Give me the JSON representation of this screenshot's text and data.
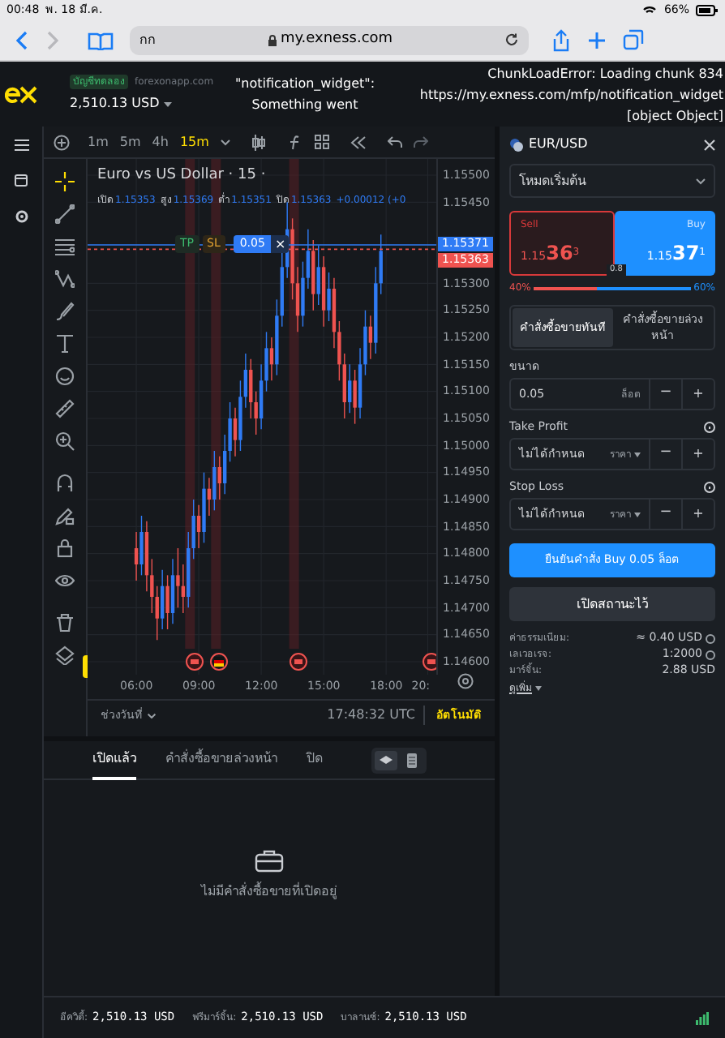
{
  "status_bar": {
    "time": "00:48",
    "date": "พ. 18 มี.ค.",
    "battery": "66%"
  },
  "browser": {
    "text_size": "กก",
    "url": "my.exness.com"
  },
  "header": {
    "account_badge": "บัญชีทดลอง",
    "server": "forexonapp.com",
    "balance": "2,510.13 USD",
    "error_1": [
      "\"notification_widget\":",
      "Something went"
    ],
    "error_2": [
      "ChunkLoadError: Loading chunk 834",
      "https://my.exness.com/mfp/notification_widget",
      "[object Object]"
    ]
  },
  "timeframes": [
    {
      "label": "1m",
      "selected": false
    },
    {
      "label": "5m",
      "selected": false
    },
    {
      "label": "4h",
      "selected": false
    },
    {
      "label": "15m",
      "selected": true
    }
  ],
  "chart": {
    "title": "Euro vs US Dollar · 15 ·",
    "ohlc": [
      {
        "label": "เปิด",
        "value": "1.15353"
      },
      {
        "label": "สูง",
        "value": "1.15369"
      },
      {
        "label": "ต่ำ",
        "value": "1.15351"
      },
      {
        "label": "ปิด",
        "value": "1.15363"
      }
    ],
    "change": "+0.00012 (+0",
    "order_line": {
      "tp": "TP",
      "sl": "SL",
      "volume": "0.05",
      "close": "×"
    },
    "chart_data": {
      "type": "candlestick",
      "x": [
        6,
        6.25,
        6.5,
        6.75,
        7,
        7.25,
        7.5,
        7.75,
        8,
        8.25,
        8.5,
        8.75,
        9,
        9.25,
        9.5,
        9.75,
        10,
        10.25,
        10.5,
        10.75,
        11,
        11.25,
        11.5,
        11.75,
        12,
        12.25,
        12.5,
        12.75,
        13,
        13.25,
        13.5,
        13.75,
        14,
        14.25,
        14.5,
        14.75,
        15,
        15.25,
        15.5,
        15.75,
        16,
        16.25,
        16.5,
        16.75,
        17,
        17.25,
        17.5,
        17.75
      ],
      "xlim": [
        3.66,
        20.41
      ],
      "ylim": [
        1.14576,
        1.1553
      ],
      "grid": true,
      "ref_lines": [
        {
          "axis": "y",
          "value": 1.15371,
          "label": "1.15371",
          "color": "#2f7bf5"
        },
        {
          "axis": "y",
          "value": 1.15363,
          "label": "1.15363",
          "color": "#ef5350"
        }
      ],
      "ohlc": [
        [
          1.1481,
          1.1484,
          1.1475,
          1.1478
        ],
        [
          1.1478,
          1.1487,
          1.1476,
          1.1484
        ],
        [
          1.1484,
          1.1486,
          1.1473,
          1.1476
        ],
        [
          1.1476,
          1.1479,
          1.1469,
          1.1472
        ],
        [
          1.1472,
          1.1474,
          1.1464,
          1.1468
        ],
        [
          1.1468,
          1.1477,
          1.1466,
          1.1474
        ],
        [
          1.1474,
          1.1476,
          1.1466,
          1.1469
        ],
        [
          1.1469,
          1.1479,
          1.1467,
          1.1476
        ],
        [
          1.1476,
          1.1481,
          1.147,
          1.1474
        ],
        [
          1.1474,
          1.1478,
          1.1469,
          1.1472
        ],
        [
          1.1472,
          1.1484,
          1.147,
          1.1481
        ],
        [
          1.1481,
          1.149,
          1.1479,
          1.1487
        ],
        [
          1.1487,
          1.1489,
          1.1481,
          1.1484
        ],
        [
          1.1484,
          1.1495,
          1.1482,
          1.1492
        ],
        [
          1.1492,
          1.1494,
          1.1487,
          1.149
        ],
        [
          1.149,
          1.1499,
          1.1488,
          1.1496
        ],
        [
          1.1496,
          1.1498,
          1.149,
          1.1493
        ],
        [
          1.1493,
          1.1502,
          1.1491,
          1.1499
        ],
        [
          1.1499,
          1.1508,
          1.1497,
          1.1505
        ],
        [
          1.1505,
          1.1507,
          1.1498,
          1.1501
        ],
        [
          1.1501,
          1.1512,
          1.1499,
          1.1509
        ],
        [
          1.1509,
          1.1517,
          1.1507,
          1.1514
        ],
        [
          1.1514,
          1.1516,
          1.1505,
          1.1508
        ],
        [
          1.1508,
          1.151,
          1.1502,
          1.1505
        ],
        [
          1.1505,
          1.1515,
          1.1503,
          1.1512
        ],
        [
          1.1512,
          1.1521,
          1.151,
          1.1518
        ],
        [
          1.1518,
          1.152,
          1.1512,
          1.1515
        ],
        [
          1.1515,
          1.1527,
          1.1513,
          1.1524
        ],
        [
          1.1524,
          1.1536,
          1.1522,
          1.1533
        ],
        [
          1.1533,
          1.1545,
          1.1531,
          1.154
        ],
        [
          1.154,
          1.1542,
          1.1527,
          1.153
        ],
        [
          1.153,
          1.1533,
          1.1521,
          1.1524
        ],
        [
          1.1524,
          1.1534,
          1.1522,
          1.1531
        ],
        [
          1.1531,
          1.154,
          1.1529,
          1.1536
        ],
        [
          1.1536,
          1.1538,
          1.1525,
          1.1528
        ],
        [
          1.1528,
          1.1537,
          1.1526,
          1.1533
        ],
        [
          1.1533,
          1.1535,
          1.1522,
          1.1525
        ],
        [
          1.1525,
          1.1532,
          1.1523,
          1.1529
        ],
        [
          1.1529,
          1.1531,
          1.1518,
          1.1521
        ],
        [
          1.1521,
          1.1523,
          1.1512,
          1.1515
        ],
        [
          1.1515,
          1.1517,
          1.1505,
          1.1508
        ],
        [
          1.1508,
          1.1515,
          1.1506,
          1.1512
        ],
        [
          1.1512,
          1.1514,
          1.1504,
          1.1507
        ],
        [
          1.1507,
          1.1518,
          1.1505,
          1.1515
        ],
        [
          1.1515,
          1.1525,
          1.1513,
          1.1522
        ],
        [
          1.1522,
          1.1524,
          1.1516,
          1.1519
        ],
        [
          1.1519,
          1.1533,
          1.1517,
          1.153
        ],
        [
          1.153,
          1.1539,
          1.1528,
          1.1536
        ]
      ],
      "xticks": [
        {
          "value": 6,
          "label": "06:00"
        },
        {
          "value": 9,
          "label": "09:00"
        },
        {
          "value": 12,
          "label": "12:00"
        },
        {
          "value": 15,
          "label": "15:00"
        },
        {
          "value": 18,
          "label": "18:00"
        },
        {
          "value": 20,
          "label": "20:"
        }
      ],
      "yticks": [
        {
          "value": 1.155,
          "label": "1.15500"
        },
        {
          "value": 1.1545,
          "label": "1.15450"
        },
        {
          "value": 1.153,
          "label": "1.15300"
        },
        {
          "value": 1.1525,
          "label": "1.15250"
        },
        {
          "value": 1.152,
          "label": "1.15200"
        },
        {
          "value": 1.1515,
          "label": "1.15150"
        },
        {
          "value": 1.151,
          "label": "1.15100"
        },
        {
          "value": 1.1505,
          "label": "1.15050"
        },
        {
          "value": 1.15,
          "label": "1.15000"
        },
        {
          "value": 1.1495,
          "label": "1.14950"
        },
        {
          "value": 1.149,
          "label": "1.14900"
        },
        {
          "value": 1.1485,
          "label": "1.14850"
        },
        {
          "value": 1.148,
          "label": "1.14800"
        },
        {
          "value": 1.1475,
          "label": "1.14750"
        },
        {
          "value": 1.147,
          "label": "1.14700"
        },
        {
          "value": 1.1465,
          "label": "1.14650"
        },
        {
          "value": 1.146,
          "label": "1.14600"
        }
      ]
    },
    "date_range": "ช่วงวันที่",
    "clock": "17:48:32 UTC",
    "auto": "อัตโนมัติ"
  },
  "bottom_tabs": [
    {
      "label": "เปิดแล้ว",
      "selected": true
    },
    {
      "label": "คำสั่งซื้อขายล่วงหน้า",
      "selected": false
    },
    {
      "label": "ปิด",
      "selected": false
    }
  ],
  "empty_message": "ไม่มีคำสั่งซื้อขายที่เปิดอยู่",
  "footer": [
    {
      "label": "อีควิตี้:",
      "value": "2,510.13 USD"
    },
    {
      "label": "ฟรีมาร์จิ้น:",
      "value": "2,510.13 USD"
    },
    {
      "label": "บาลานซ์:",
      "value": "2,510.13 USD"
    }
  ],
  "order_panel": {
    "symbol": "EUR/USD",
    "mode": "โหมดเริ่มต้น",
    "sell": {
      "label": "Sell",
      "price_main": "1.15",
      "price_big": "36",
      "price_sup": "3"
    },
    "buy": {
      "label": "Buy",
      "price_main": "1.15",
      "price_big": "37",
      "price_sup": "1"
    },
    "spread": "0.8",
    "sell_pct": "40%",
    "buy_pct": "60%",
    "level": 0.4,
    "order_types": [
      {
        "label": "คำสั่งซื้อขายทันที",
        "selected": true
      },
      {
        "label": "คำสั่งซื้อขายล่วงหน้า",
        "selected": false
      }
    ],
    "fields": [
      {
        "kind": "volume",
        "label": "ขนาด",
        "value": "0.05",
        "unit": "ล็อต",
        "help": false,
        "decrease": "−",
        "increase": "+"
      },
      {
        "kind": "take_profit",
        "label": "Take Profit",
        "value": "ไม่ได้กำหนด",
        "unit": "ราคา",
        "help": true,
        "decrease": "−",
        "increase": "+"
      },
      {
        "kind": "stop_loss",
        "label": "Stop Loss",
        "value": "ไม่ได้กำหนด",
        "unit": "ราคา",
        "help": true,
        "decrease": "−",
        "increase": "+"
      }
    ],
    "confirm": "ยืนยันคำสั่ง Buy 0.05 ล็อต",
    "open_position": "เปิดสถานะไว้",
    "info": [
      {
        "label": "ค่าธรรมเนียม:",
        "value": "≈ 0.40 USD",
        "help": true
      },
      {
        "label": "เลเวอเรจ:",
        "value": "1:2000",
        "help": true
      },
      {
        "label": "มาร์จิ้น:",
        "value": "2.88 USD",
        "help": false
      }
    ],
    "more": "ดูเพิ่ม"
  }
}
